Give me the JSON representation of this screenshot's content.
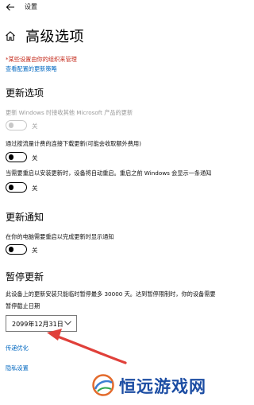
{
  "window": {
    "title": "设置"
  },
  "header": {
    "title": "高级选项"
  },
  "notice": {
    "warning": "*某些设置由你的组织来管理",
    "policy_link": "查看配置的更新策略"
  },
  "update_options": {
    "heading": "更新选项",
    "items": [
      {
        "label": "更新 Windows 时接收其他 Microsoft 产品的更新",
        "state": "关",
        "disabled": true
      },
      {
        "label": "通过按流量计费的连接下载更新(可能会收取额外费用)",
        "state": "关",
        "disabled": false
      },
      {
        "label": "当需要重启以安装更新时，设备将自动重启。重启之前 Windows 会显示一条通知",
        "state": "关",
        "disabled": false
      }
    ]
  },
  "update_notifications": {
    "heading": "更新通知",
    "items": [
      {
        "label": "在你的电脑需要重启以完成更新时显示通知",
        "state": "关",
        "disabled": false
      }
    ]
  },
  "pause_updates": {
    "heading": "暂停更新",
    "description": "此设备上的更新安装只能临时暂停最多 30000 天。达到暂停限制时，你的设备需要",
    "date_label": "暂停截止日期",
    "selected_date": "2099年12月31日"
  },
  "links": {
    "delivery_optimization": "传递优化",
    "privacy_settings": "隐私设置"
  },
  "watermark": {
    "text": "恒远游戏网"
  },
  "colors": {
    "link": "#0067c0",
    "warning": "#c42b1c",
    "arrow": "#e0403a",
    "watermark": "#1c4da3"
  },
  "icons": [
    "back-arrow-icon",
    "home-icon",
    "chevron-down-icon",
    "annotation-arrow",
    "watermark-logo-icon"
  ]
}
